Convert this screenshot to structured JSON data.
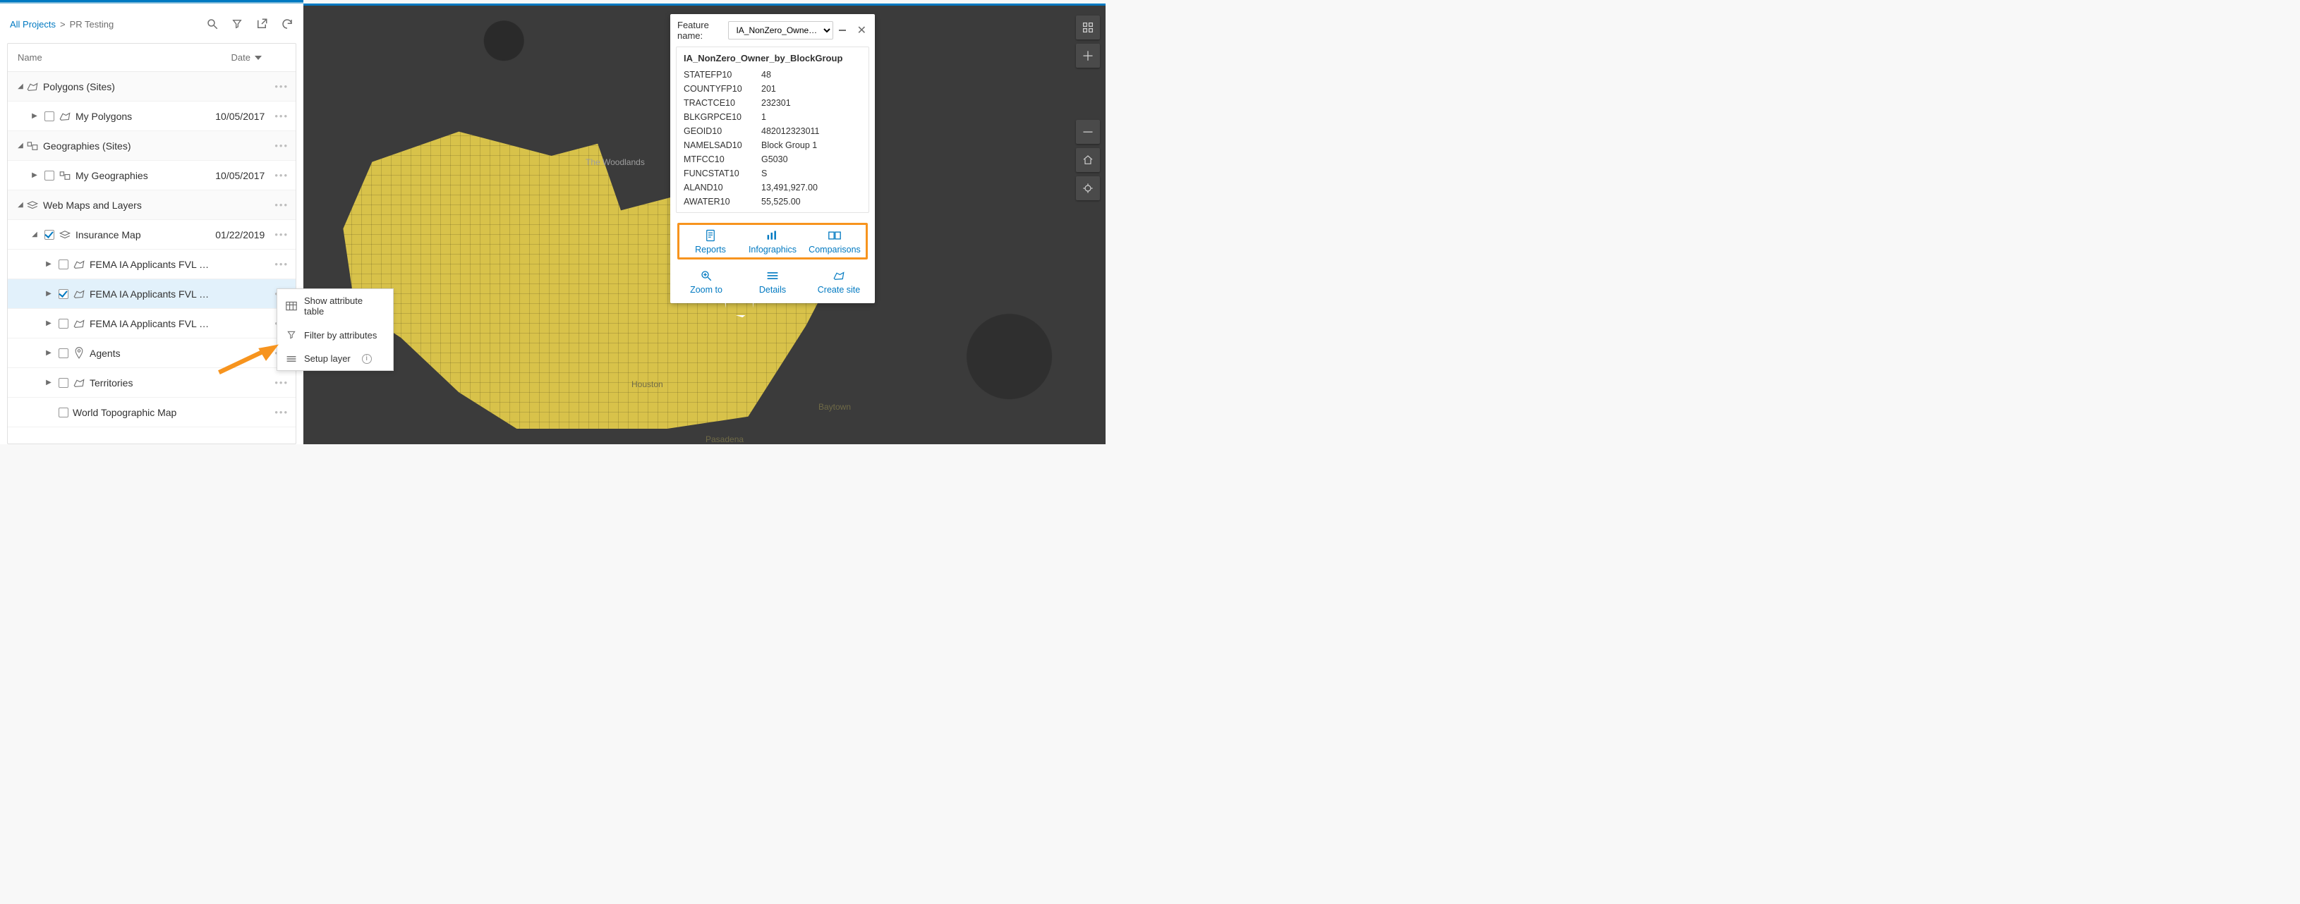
{
  "breadcrumb": {
    "root": "All Projects",
    "current": "PR Testing"
  },
  "columns": {
    "name": "Name",
    "date": "Date"
  },
  "tree": {
    "polygons_sites": {
      "label": "Polygons (Sites)"
    },
    "my_polygons": {
      "label": "My Polygons",
      "date": "10/05/2017"
    },
    "geographies_sites": {
      "label": "Geographies (Sites)"
    },
    "my_geographies": {
      "label": "My Geographies",
      "date": "10/05/2017"
    },
    "webmaps": {
      "label": "Web Maps and Layers"
    },
    "insurance_map": {
      "label": "Insurance Map",
      "date": "01/22/2019"
    },
    "fema1": {
      "label": "FEMA IA Applicants FVL …"
    },
    "fema2": {
      "label": "FEMA IA Applicants FVL …"
    },
    "fema3": {
      "label": "FEMA IA Applicants FVL …"
    },
    "agents": {
      "label": "Agents"
    },
    "territories": {
      "label": "Territories"
    },
    "world_topo": {
      "label": "World Topographic Map"
    }
  },
  "context_menu": {
    "attr_table": "Show attribute table",
    "filter": "Filter by attributes",
    "setup": "Setup layer"
  },
  "map_labels": {
    "woodlands": "The Woodlands",
    "houston": "Houston",
    "baytown": "Baytown",
    "pasadena": "Pasadena"
  },
  "popup": {
    "feature_name_label": "Feature name:",
    "feature_selected": "IA_NonZero_Owne…",
    "title": "IA_NonZero_Owner_by_BlockGroup",
    "fields": [
      {
        "k": "STATEFP10",
        "v": "48"
      },
      {
        "k": "COUNTYFP10",
        "v": "201"
      },
      {
        "k": "TRACTCE10",
        "v": "232301"
      },
      {
        "k": "BLKGRPCE10",
        "v": "1"
      },
      {
        "k": "GEOID10",
        "v": "482012323011"
      },
      {
        "k": "NAMELSAD10",
        "v": "Block Group 1"
      },
      {
        "k": "MTFCC10",
        "v": "G5030"
      },
      {
        "k": "FUNCSTAT10",
        "v": "S"
      },
      {
        "k": "ALAND10",
        "v": "13,491,927.00"
      },
      {
        "k": "AWATER10",
        "v": "55,525.00"
      }
    ],
    "actions": {
      "reports": "Reports",
      "infographics": "Infographics",
      "comparisons": "Comparisons",
      "zoom": "Zoom to",
      "details": "Details",
      "create_site": "Create site"
    }
  }
}
